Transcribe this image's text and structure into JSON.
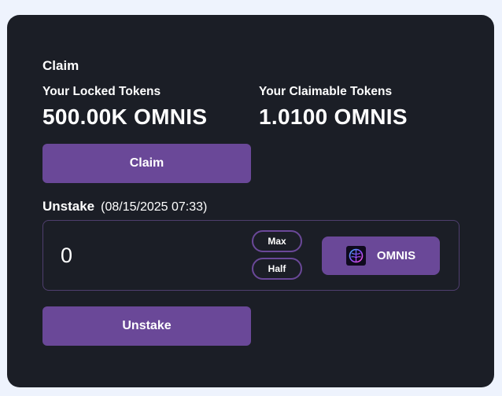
{
  "claim": {
    "title": "Claim",
    "locked_label": "Your Locked Tokens",
    "locked_value": "500.00K OMNIS",
    "claimable_label": "Your Claimable Tokens",
    "claimable_value": "1.0100 OMNIS",
    "button_label": "Claim"
  },
  "unstake": {
    "title": "Unstake",
    "date": "(08/15/2025 07:33)",
    "amount_value": "0",
    "max_label": "Max",
    "half_label": "Half",
    "token_symbol": "OMNIS",
    "token_icon": "omnis-brain-icon",
    "button_label": "Unstake"
  },
  "colors": {
    "page_background": "#eef3fd",
    "card_background": "#1b1e26",
    "accent": "#6a4898",
    "input_border": "#4f3f6e",
    "text": "#ffffff"
  }
}
